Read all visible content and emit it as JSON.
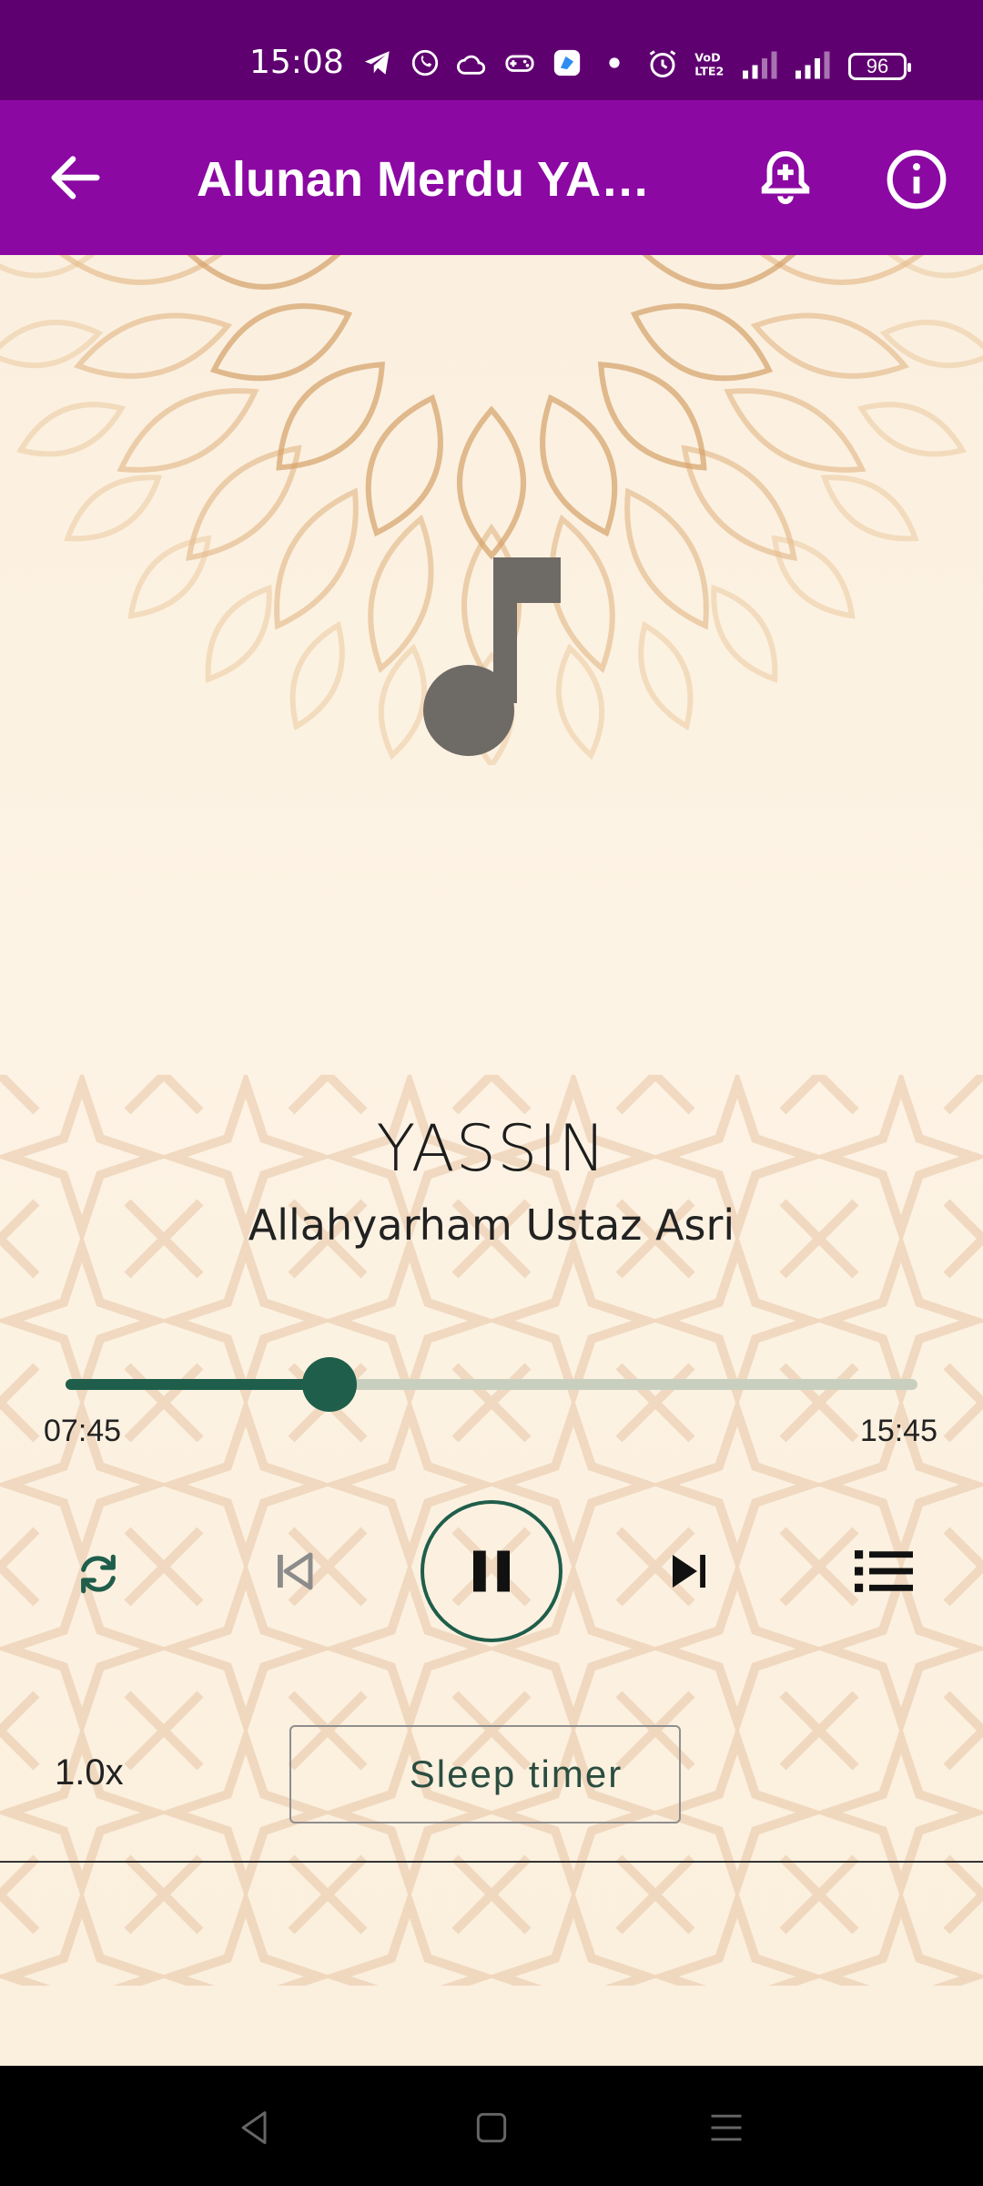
{
  "status_bar": {
    "time": "15:08",
    "battery": "96"
  },
  "app_bar": {
    "title": "Alunan Merdu YASSIN"
  },
  "player": {
    "track_title": "YASSIN",
    "artist": "Allahyarham Ustaz Asri",
    "position": "07:45",
    "duration": "15:45",
    "progress_fraction": 0.31,
    "speed_label": "1.0x",
    "sleep_timer_label": "Sleep timer"
  },
  "colors": {
    "status_bar": "#5f0070",
    "app_bar": "#8b08a3",
    "accent": "#1f5e4b"
  },
  "icons": [
    "back-arrow-icon",
    "bell-add-icon",
    "info-icon",
    "music-note-icon",
    "repeat-icon",
    "skip-previous-icon",
    "pause-icon",
    "skip-next-icon",
    "queue-list-icon",
    "moon-icon",
    "nav-back-icon",
    "nav-home-icon",
    "nav-menu-icon"
  ]
}
